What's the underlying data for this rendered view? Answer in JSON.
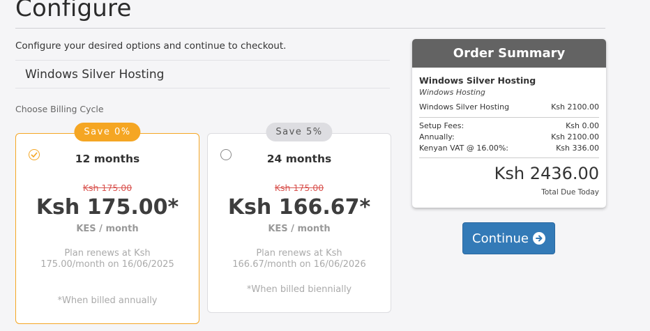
{
  "page": {
    "title": "Configure",
    "subtitle": "Configure your desired options and continue to checkout."
  },
  "product": {
    "name": "Windows Silver Hosting"
  },
  "billing": {
    "label": "Choose Billing Cycle",
    "selected_index": 0,
    "options": [
      {
        "badge": "Save 0%",
        "name": "12 months",
        "old_price": "Ksh 175.00",
        "price": "Ksh 175.00*",
        "per": "KES / month",
        "renew": "Plan renews at Ksh 175.00/month on 16/06/2025",
        "note": "*When billed annually"
      },
      {
        "badge": "Save 5%",
        "name": "24 months",
        "old_price": "Ksh 175.00",
        "price": "Ksh 166.67*",
        "per": "KES / month",
        "renew": "Plan renews at Ksh 166.67/month on 16/06/2026",
        "note": "*When billed biennially"
      }
    ]
  },
  "summary": {
    "heading": "Order Summary",
    "product_name": "Windows Silver Hosting",
    "product_group": "Windows Hosting",
    "lines": [
      {
        "label": "Windows Silver Hosting",
        "value": "Ksh 2100.00"
      },
      {
        "label": "Setup Fees:",
        "value": "Ksh 0.00"
      },
      {
        "label": "Annually:",
        "value": "Ksh 2100.00"
      },
      {
        "label": "Kenyan VAT @ 16.00%:",
        "value": "Ksh 336.00"
      }
    ],
    "total": "Ksh 2436.00",
    "total_label": "Total Due Today"
  },
  "actions": {
    "continue_label": "Continue"
  },
  "colors": {
    "accent": "#f5a623",
    "primary_button": "#337ab7",
    "summary_header": "#636363",
    "strike_price": "#d9534f"
  },
  "icons": {
    "continue": "arrow-circle-right-icon",
    "selected_radio": "check-circle-icon"
  }
}
